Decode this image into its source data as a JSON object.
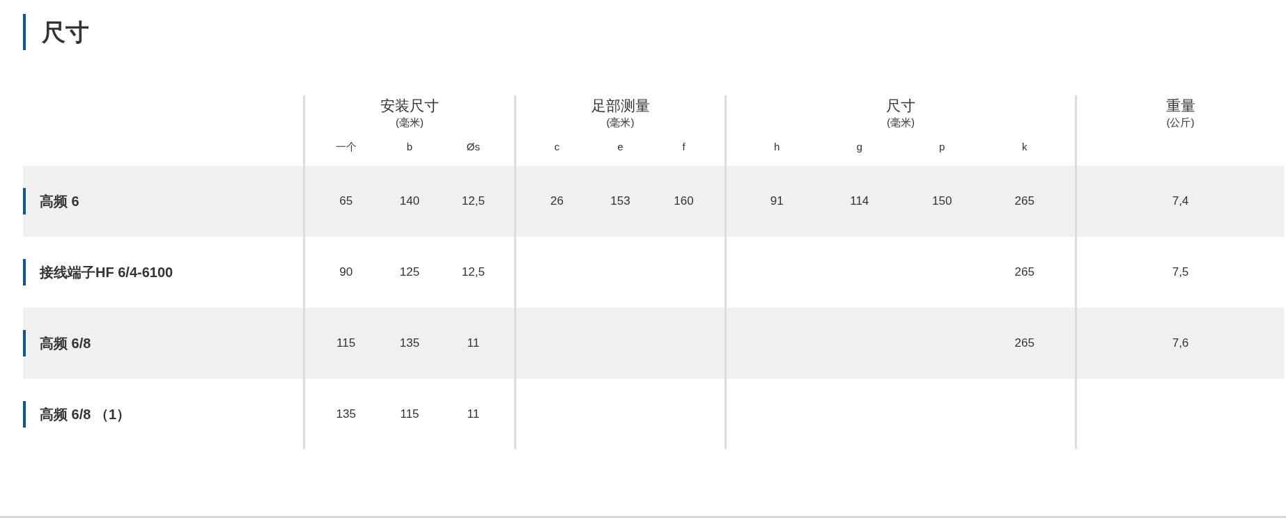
{
  "title": "尺寸",
  "table": {
    "groups": [
      {
        "title": "安装尺寸",
        "unit": "(毫米)",
        "columns": [
          "一个",
          "b",
          "Øs"
        ]
      },
      {
        "title": "足部测量",
        "unit": "(毫米)",
        "columns": [
          "c",
          "e",
          "f"
        ]
      },
      {
        "title": "尺寸",
        "unit": "(毫米)",
        "columns": [
          "h",
          "g",
          "p",
          "k"
        ]
      },
      {
        "title": "重量",
        "unit": "(公斤)"
      }
    ],
    "rows": [
      {
        "name": "高频 6",
        "cells": [
          [
            "65",
            "140",
            "12,5"
          ],
          [
            "26",
            "153",
            "160"
          ],
          [
            "91",
            "114",
            "150",
            "265"
          ],
          [
            "7,4"
          ]
        ]
      },
      {
        "name": "接线端子HF 6/4-6100",
        "cells": [
          [
            "90",
            "125",
            "12,5"
          ],
          [
            null,
            null,
            null
          ],
          [
            null,
            null,
            null,
            "265"
          ],
          [
            "7,5"
          ]
        ]
      },
      {
        "name": "高频 6/8",
        "cells": [
          [
            "115",
            "135",
            "11"
          ],
          [
            null,
            null,
            null
          ],
          [
            null,
            null,
            null,
            "265"
          ],
          [
            "7,6"
          ]
        ]
      },
      {
        "name": "高频 6/8 （1）",
        "cells": [
          [
            "135",
            "115",
            "11"
          ],
          [
            null,
            null,
            null
          ],
          [
            null,
            null,
            null,
            null
          ],
          [
            null
          ]
        ]
      }
    ]
  }
}
